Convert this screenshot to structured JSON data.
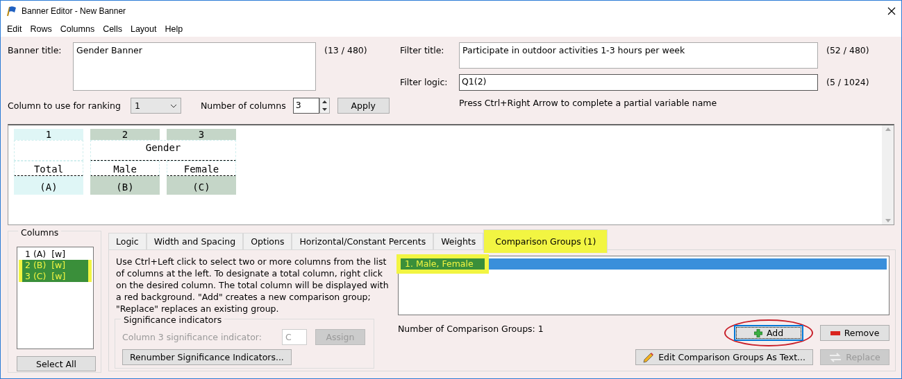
{
  "window": {
    "title": "Banner Editor - New Banner"
  },
  "menu": [
    "Edit",
    "Rows",
    "Columns",
    "Cells",
    "Layout",
    "Help"
  ],
  "banner_title": {
    "label": "Banner title:",
    "value": "Gender Banner",
    "count": "(13 / 480)"
  },
  "ranking": {
    "label": "Column to use for ranking",
    "value": "1"
  },
  "number_of_columns": {
    "label": "Number of columns",
    "value": "3"
  },
  "apply_button": "Apply",
  "filter_title": {
    "label": "Filter title:",
    "value": "Participate in outdoor activities 1-3 hours per week",
    "count": "(52 / 480)"
  },
  "filter_logic": {
    "label": "Filter logic:",
    "value": "Q1(2)",
    "count": "(5 / 1024)"
  },
  "filter_hint": "Press Ctrl+Right Arrow to complete a partial variable name",
  "preview": {
    "groups": [
      {
        "columns": [
          {
            "number": "1",
            "label": "Total",
            "letter": "(A)",
            "kind": "total"
          }
        ]
      },
      {
        "title": "Gender",
        "columns": [
          {
            "number": "2",
            "label": "Male",
            "letter": "(B)",
            "kind": "banner"
          },
          {
            "number": "3",
            "label": "Female",
            "letter": "(C)",
            "kind": "banner"
          }
        ]
      }
    ]
  },
  "columns_panel": {
    "title": "Columns",
    "items": [
      {
        "text": "1 (A)  [w]",
        "selected": false
      },
      {
        "text": "2 (B)  [w]",
        "selected": true
      },
      {
        "text": "3 (C)  [w]",
        "selected": true
      }
    ],
    "select_all": "Select All"
  },
  "tabs": [
    {
      "label": "Logic",
      "selected": false
    },
    {
      "label": "Width and Spacing",
      "selected": false
    },
    {
      "label": "Options",
      "selected": false
    },
    {
      "label": "Horizontal/Constant Percents",
      "selected": false
    },
    {
      "label": "Weights",
      "selected": false
    },
    {
      "label": "Comparison Groups (1)",
      "selected": true
    }
  ],
  "comparison": {
    "instructions": "Use Ctrl+Left click to select two or more columns from the list of columns at the left. To designate a total column, right click on the desired column. The total column will be displayed with a red background. \"Add\" creates a new comparison group; \"Replace\" replaces an existing group.",
    "significance": {
      "title": "Significance indicators",
      "label": "Column 3 significance indicator:",
      "indicator": {
        "value": "C",
        "disabled": true
      },
      "assign": {
        "label": "Assign",
        "disabled": true
      },
      "renumber": "Renumber Significance Indicators..."
    },
    "groups": [
      {
        "text": "1. Male, Female",
        "selected": true
      }
    ],
    "count": "Number of Comparison Groups: 1",
    "buttons": [
      {
        "kind": "add",
        "label": "Add",
        "disabled": false,
        "circled": true
      },
      {
        "kind": "remove",
        "label": "Remove",
        "disabled": false,
        "circled": false
      },
      {
        "kind": "edit",
        "label": "Edit Comparison Groups As Text...",
        "disabled": false,
        "circled": false
      },
      {
        "kind": "replace",
        "label": "Replace",
        "disabled": true,
        "circled": false
      }
    ]
  }
}
